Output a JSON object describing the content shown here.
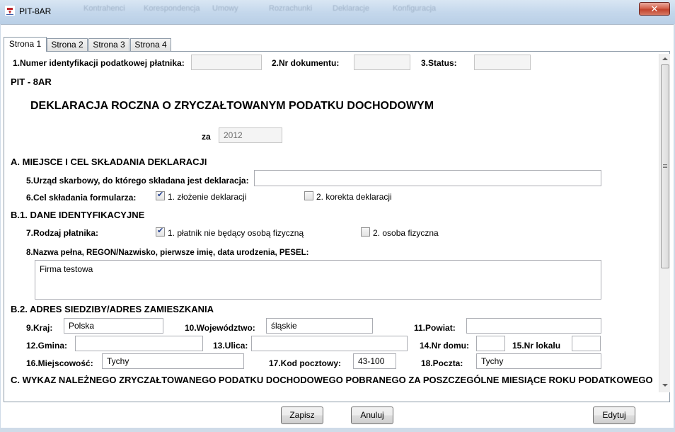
{
  "window": {
    "title": "PIT-8AR",
    "close_glyph": "✕",
    "blurred_menu": [
      "Kontrahenci",
      "Korespondencja",
      "Umowy",
      "Rozrachunki",
      "Deklaracje",
      "Konfiguracja"
    ]
  },
  "tabs": [
    "Strona 1",
    "Strona 2",
    "Strona 3",
    "Strona 4"
  ],
  "header": {
    "f1_label": "1.Numer identyfikacji podatkowej płatnika:",
    "f1_value": "",
    "f2_label": "2.Nr dokumentu:",
    "f2_value": "",
    "f3_label": "3.Status:",
    "f3_value": ""
  },
  "form_code": "PIT - 8AR",
  "form_title": "DEKLARACJA ROCZNA O ZRYCZAŁTOWANYM PODATKU DOCHODOWYM",
  "year": {
    "label": "za",
    "value": "2012"
  },
  "sectionA": {
    "title": "A. MIEJSCE I CEL SKŁADANIA DEKLARACJI",
    "f5_label": "5.Urząd skarbowy, do którego składana jest deklaracja:",
    "f5_value": "",
    "f6_label": "6.Cel składania formularza:",
    "opt1": "1. złożenie deklaracji",
    "opt1_checked": true,
    "opt2": "2. korekta deklaracji",
    "opt2_checked": false
  },
  "sectionB1": {
    "title": "B.1. DANE IDENTYFIKACYJNE",
    "f7_label": "7.Rodzaj płatnika:",
    "opt1": "1. płatnik nie będący osobą fizyczną",
    "opt1_checked": true,
    "opt2": "2. osoba fizyczna",
    "opt2_checked": false,
    "f8_label": "8.Nazwa pełna, REGON/Nazwisko, pierwsze imię, data urodzenia, PESEL:",
    "f8_value": "Firma testowa"
  },
  "sectionB2": {
    "title": "B.2. ADRES SIEDZIBY/ADRES ZAMIESZKANIA",
    "f9_label": "9.Kraj:",
    "f9_value": "Polska",
    "f10_label": "10.Województwo:",
    "f10_value": "śląskie",
    "f11_label": "11.Powiat:",
    "f11_value": "",
    "f12_label": "12.Gmina:",
    "f12_value": "",
    "f13_label": "13.Ulica:",
    "f13_value": "",
    "f14_label": "14.Nr domu:",
    "f14_value": "",
    "f15_label": "15.Nr lokalu",
    "f15_value": "",
    "f16_label": "16.Miejscowość:",
    "f16_value": "Tychy",
    "f17_label": "17.Kod pocztowy:",
    "f17_value": "43-100",
    "f18_label": "18.Poczta:",
    "f18_value": "Tychy"
  },
  "sectionC": {
    "title": "C. WYKAZ NALEŻNEGO ZRYCZAŁTOWANEGO PODATKU DOCHODOWEGO POBRANEGO ZA POSZCZEGÓLNE MIESIĄCE ROKU PODATKOWEGO"
  },
  "buttons": {
    "save": "Zapisz",
    "cancel": "Anuluj",
    "edit": "Edytuj"
  }
}
